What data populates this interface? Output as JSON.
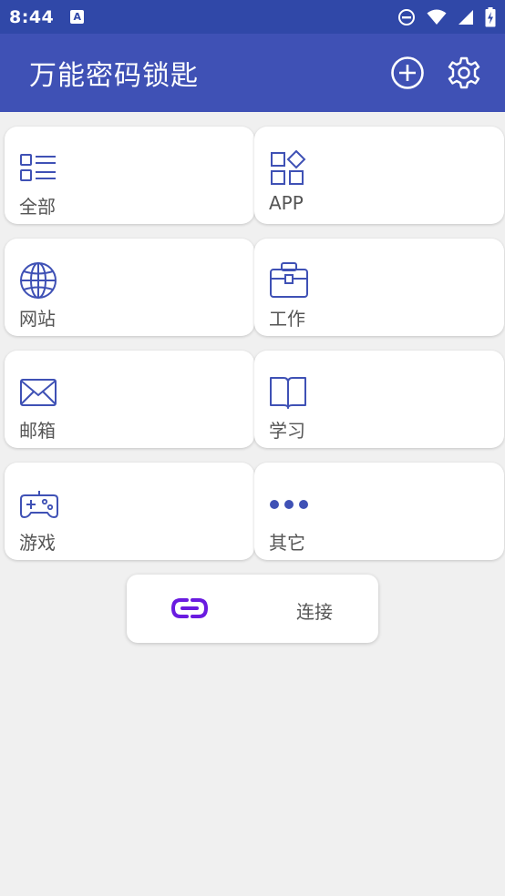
{
  "status_bar": {
    "time": "8:44",
    "notification_letter": "A"
  },
  "app_bar": {
    "title": "万能密码锁匙"
  },
  "categories": [
    {
      "label": "全部",
      "icon": "list-icon"
    },
    {
      "label": "APP",
      "icon": "apps-icon"
    },
    {
      "label": "网站",
      "icon": "globe-icon"
    },
    {
      "label": "工作",
      "icon": "briefcase-icon"
    },
    {
      "label": "邮箱",
      "icon": "mail-icon"
    },
    {
      "label": "学习",
      "icon": "book-icon"
    },
    {
      "label": "游戏",
      "icon": "gamepad-icon"
    },
    {
      "label": "其它",
      "icon": "more-icon"
    }
  ],
  "connect": {
    "label": "连接",
    "icon": "link-icon"
  },
  "colors": {
    "status_bar": "#3048a8",
    "app_bar": "#3f51b5",
    "icon": "#3f51b5",
    "link_icon": "#6a1be0",
    "background": "#f0f0f0"
  }
}
